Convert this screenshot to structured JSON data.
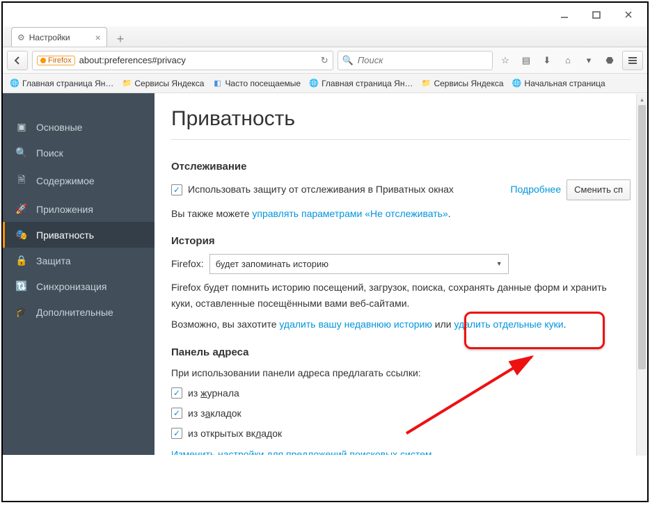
{
  "window": {
    "tab_title": "Настройки"
  },
  "urlbar": {
    "badge": "Firefox",
    "url": "about:preferences#privacy"
  },
  "searchbar": {
    "placeholder": "Поиск"
  },
  "bookmarks": [
    {
      "label": "Главная страница Ян…",
      "icon": "globe"
    },
    {
      "label": "Сервисы Яндекса",
      "icon": "folder"
    },
    {
      "label": "Часто посещаемые",
      "icon": "blue"
    },
    {
      "label": "Главная страница Ян…",
      "icon": "globe"
    },
    {
      "label": "Сервисы Яндекса",
      "icon": "folder"
    },
    {
      "label": "Начальная страница",
      "icon": "globe"
    }
  ],
  "sidebar": {
    "items": [
      {
        "label": "Основные"
      },
      {
        "label": "Поиск"
      },
      {
        "label": "Содержимое"
      },
      {
        "label": "Приложения"
      },
      {
        "label": "Приватность"
      },
      {
        "label": "Защита"
      },
      {
        "label": "Синхронизация"
      },
      {
        "label": "Дополнительные"
      }
    ]
  },
  "page": {
    "title": "Приватность",
    "tracking": {
      "heading": "Отслеживание",
      "checkbox_label": "Использовать защиту от отслеживания в Приватных окнах",
      "learn_more": "Подробнее",
      "button": "Сменить сп",
      "line2_prefix": "Вы также можете ",
      "line2_link": "управлять параметрами «Не отслеживать»",
      "line2_suffix": "."
    },
    "history": {
      "heading": "История",
      "firefox_label": "Firefox:",
      "select_value": "будет запоминать историю",
      "desc": "Firefox будет помнить историю посещений, загрузок, поиска, сохранять данные форм и хранить куки, оставленные посещёнными вами веб-сайтами.",
      "line3_prefix": "Возможно, вы захотите ",
      "line3_link1": "удалить вашу недавнюю историю",
      "line3_mid": " или ",
      "line3_link2": "удалить отдельные куки",
      "line3_suffix": "."
    },
    "locationbar": {
      "heading": "Панель адреса",
      "intro": "При использовании панели адреса предлагать ссылки:",
      "cb1_pre": "из ",
      "cb1_u": "ж",
      "cb1_post": "урнала",
      "cb2_pre": "из з",
      "cb2_u": "а",
      "cb2_post": "кладок",
      "cb3_pre": "из открытых вк",
      "cb3_u": "л",
      "cb3_post": "адок",
      "link": "Изменить настройки для предложений поисковых систем…"
    }
  }
}
